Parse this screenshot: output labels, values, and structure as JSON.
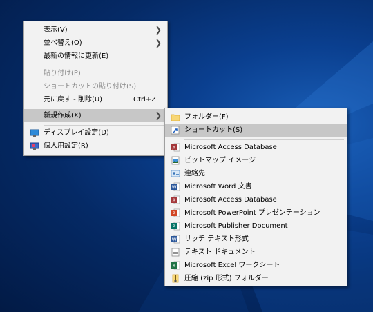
{
  "context_menu": {
    "items": [
      {
        "label": "表示(V)",
        "submenu": true
      },
      {
        "label": "並べ替え(O)",
        "submenu": true
      },
      {
        "label": "最新の情報に更新(E)"
      },
      {
        "label": "貼り付け(P)",
        "disabled": true
      },
      {
        "label": "ショートカットの貼り付け(S)",
        "disabled": true
      },
      {
        "label": "元に戻す - 削除(U)",
        "shortcut": "Ctrl+Z"
      },
      {
        "label": "新規作成(X)",
        "submenu": true,
        "highlighted": true
      },
      {
        "label": "ディスプレイ設定(D)",
        "icon": "display-icon"
      },
      {
        "label": "個人用設定(R)",
        "icon": "personalize-icon"
      }
    ]
  },
  "new_submenu": {
    "items": [
      {
        "label": "フォルダー(F)",
        "icon": "folder-icon"
      },
      {
        "label": "ショートカット(S)",
        "icon": "shortcut-icon",
        "highlighted": true
      },
      {
        "label": "Microsoft Access Database",
        "icon": "access-icon"
      },
      {
        "label": "ビットマップ イメージ",
        "icon": "bitmap-icon"
      },
      {
        "label": "連絡先",
        "icon": "contact-icon"
      },
      {
        "label": "Microsoft Word 文書",
        "icon": "word-icon"
      },
      {
        "label": "Microsoft Access Database",
        "icon": "access-icon"
      },
      {
        "label": "Microsoft PowerPoint プレゼンテーション",
        "icon": "powerpoint-icon"
      },
      {
        "label": "Microsoft Publisher Document",
        "icon": "publisher-icon"
      },
      {
        "label": "リッチ テキスト形式",
        "icon": "rtf-icon"
      },
      {
        "label": "テキスト ドキュメント",
        "icon": "text-document-icon"
      },
      {
        "label": "Microsoft Excel ワークシート",
        "icon": "excel-icon"
      },
      {
        "label": "圧縮 (zip 形式) フォルダー",
        "icon": "zip-folder-icon"
      }
    ]
  },
  "colors": {
    "menu_bg": "#f2f2f2",
    "highlight": "#c7c7c7",
    "disabled_text": "#8a8a8a",
    "desktop": "#0a3f8f"
  }
}
